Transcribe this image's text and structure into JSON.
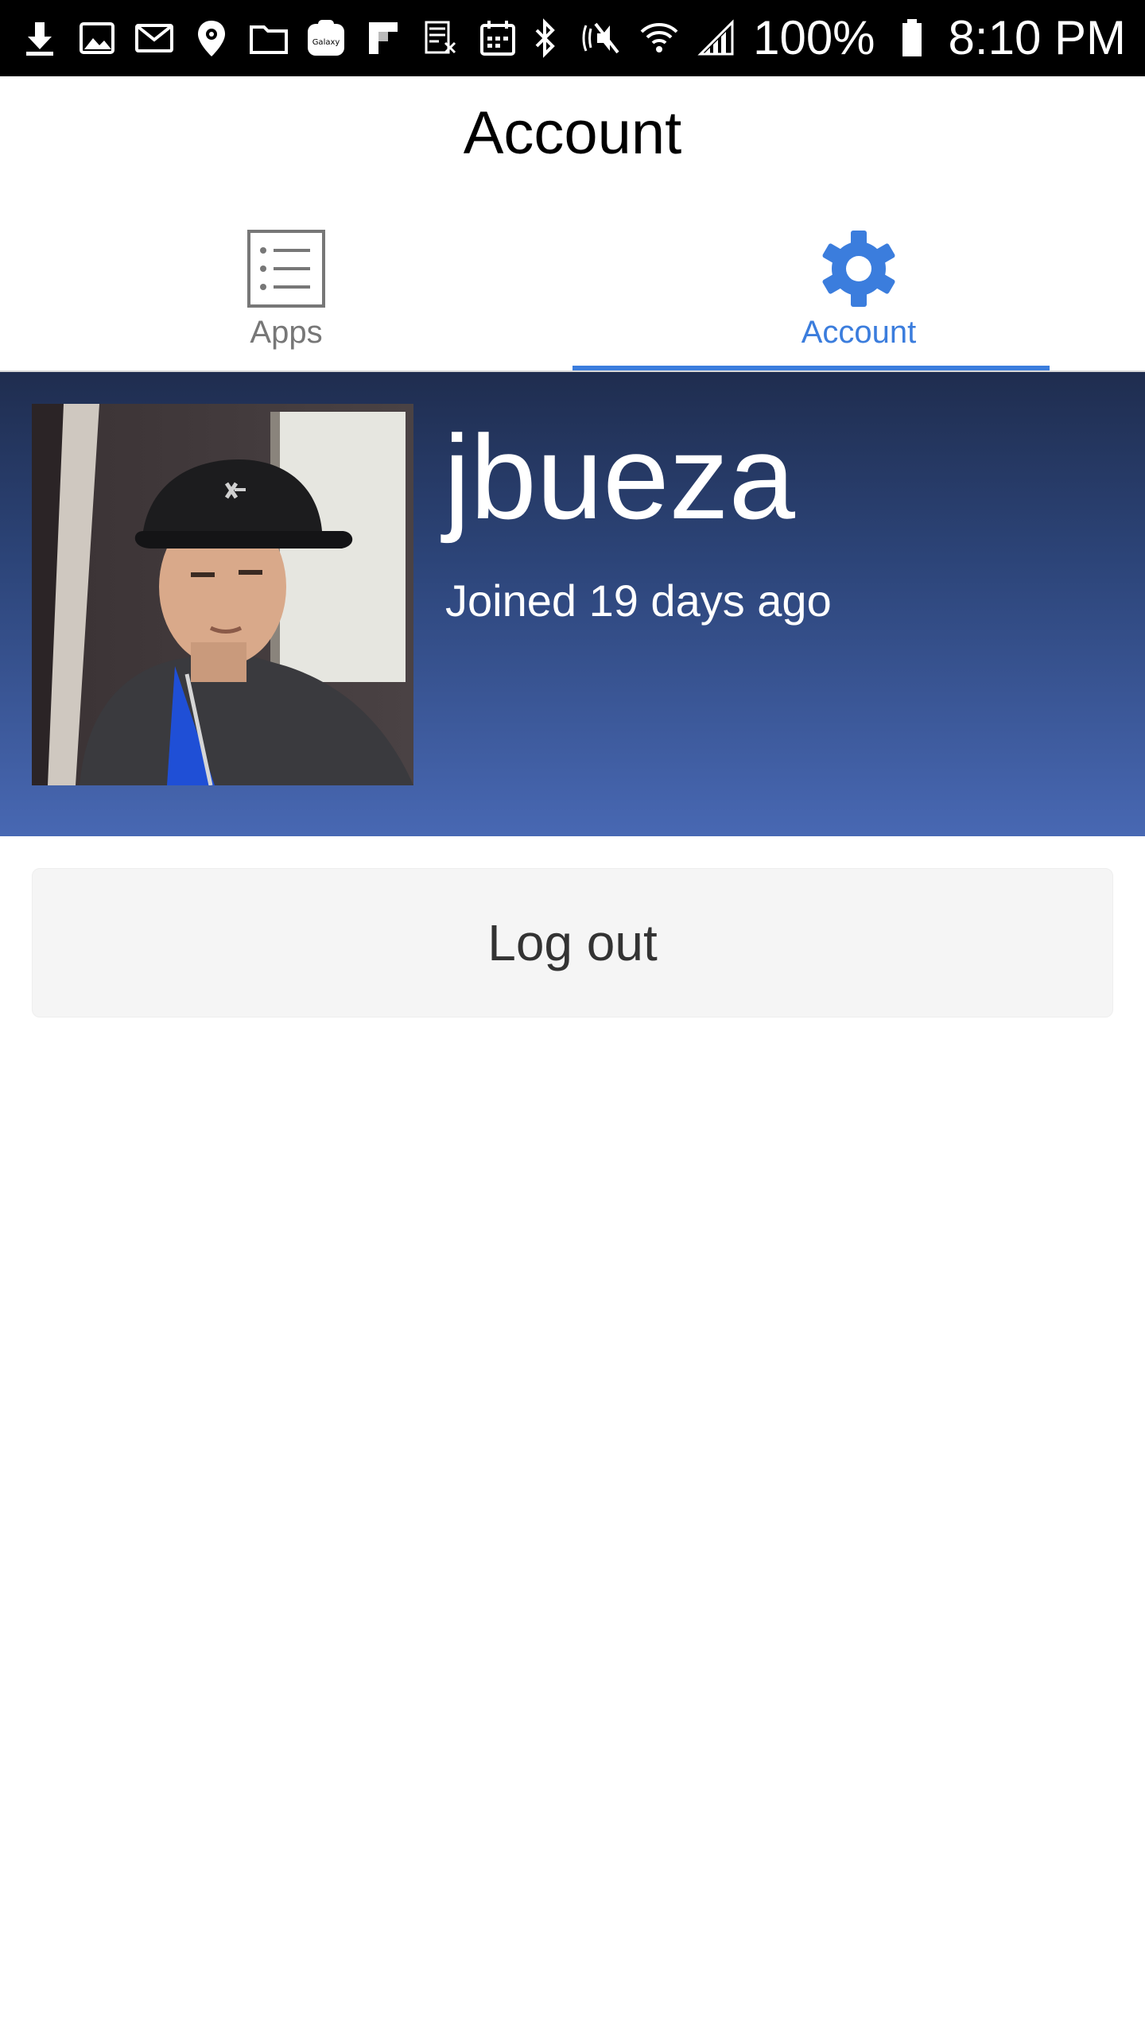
{
  "status_bar": {
    "battery": "100%",
    "time": "8:10 PM",
    "left_icons": [
      "download-icon",
      "image-icon",
      "gmail-icon",
      "location-icon",
      "folder-icon",
      "galaxy-icon",
      "flipboard-icon",
      "sheet-icon",
      "calendar-icon"
    ],
    "right_icons": [
      "bluetooth-icon",
      "nfc-mute-icon",
      "wifi-icon",
      "signal-icon",
      "battery-icon"
    ],
    "galaxy_label": "Galaxy"
  },
  "header": {
    "title": "Account"
  },
  "tabs": [
    {
      "label": "Apps",
      "icon": "list-icon",
      "selected": false
    },
    {
      "label": "Account",
      "icon": "gear-icon",
      "selected": true
    }
  ],
  "colors": {
    "accent": "#3b7ddd",
    "banner_top": "#1f2d4f",
    "banner_bottom": "#4868b3"
  },
  "profile": {
    "username": "jbueza",
    "joined": "Joined 19 days ago"
  },
  "actions": {
    "logout_label": "Log out"
  }
}
